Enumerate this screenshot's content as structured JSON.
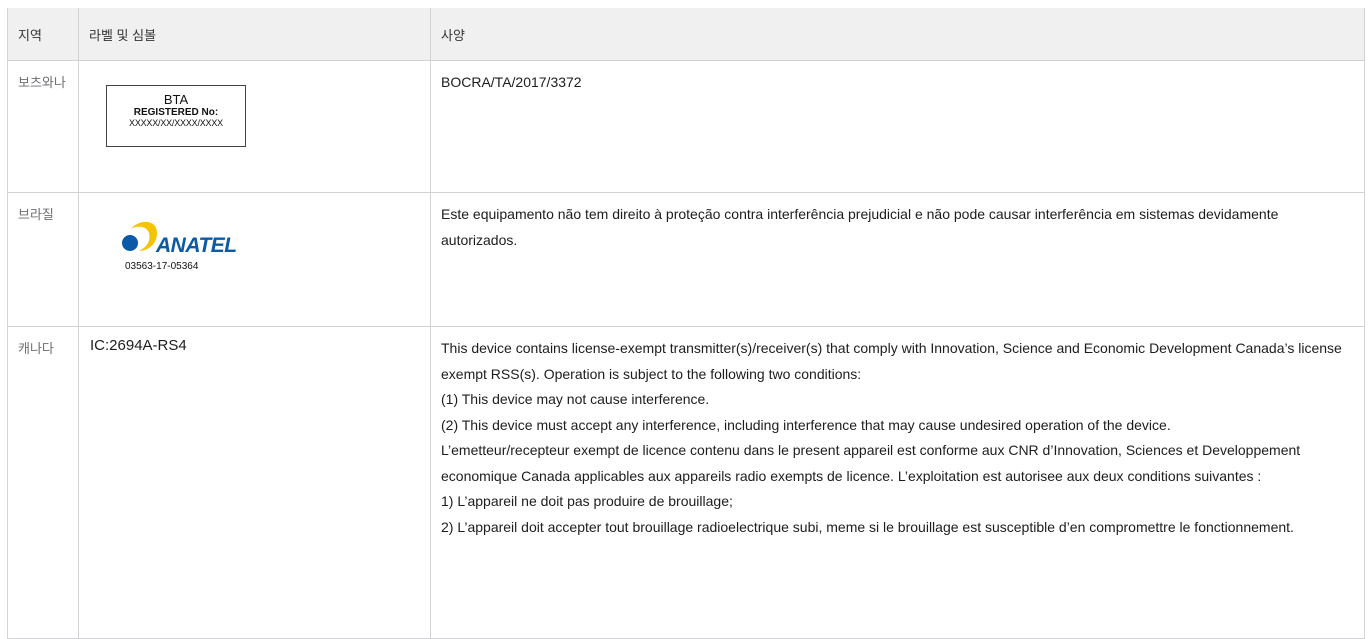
{
  "table": {
    "headers": {
      "region": "지역",
      "label": "라벨 및 심볼",
      "spec": "사양"
    },
    "rows": [
      {
        "region": "보츠와나",
        "label_box": {
          "title": "BTA",
          "registered": "REGISTERED No:",
          "number": "XXXXX/XX/XXXX/XXXX"
        },
        "spec_lines": [
          "BOCRA/TA/2017/3372"
        ]
      },
      {
        "region": "브라질",
        "logo": {
          "icon": "anatel-logo-icon",
          "wordmark": "ANATEL",
          "code": "03563-17-05364",
          "colors": {
            "blue": "#0a5aa8",
            "yellow": "#f5c400"
          }
        },
        "spec_lines": [
          "Este equipamento não tem direito à proteção contra interferência prejudicial e não pode causar interferência em sistemas devidamente autorizados."
        ]
      },
      {
        "region": "캐나다",
        "label_text": "IC:2694A-RS4",
        "spec_lines": [
          "This device contains license-exempt transmitter(s)/receiver(s) that comply with Innovation, Science and Economic Development Canada’s license exempt RSS(s). Operation is subject to the following two conditions:",
          "(1) This device may not cause interference.",
          "(2) This device must accept any interference, including interference that may cause undesired operation of the device.",
          "L’emetteur/recepteur exempt de licence contenu dans le present appareil est conforme aux CNR d’Innovation, Sciences et Developpement economique Canada applicables aux appareils radio exempts de licence. L’exploitation est autorisee aux deux conditions suivantes :",
          "1) L’appareil ne doit pas produire de brouillage;",
          "2) L’appareil doit accepter tout brouillage radioelectrique subi, meme si le brouillage est susceptible d’en compromettre le fonctionnement."
        ]
      }
    ]
  }
}
